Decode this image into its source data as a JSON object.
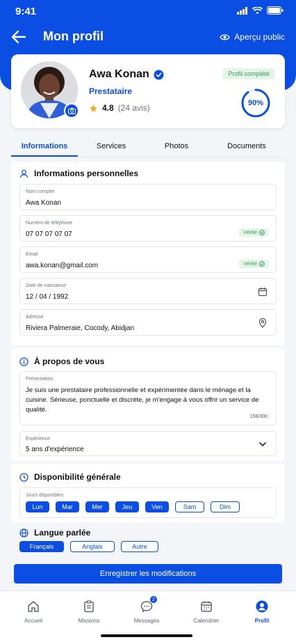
{
  "status": {
    "time": "9:41"
  },
  "header": {
    "title": "Mon profil",
    "preview_label": "Aperçu public"
  },
  "profile": {
    "name": "Awa Konan",
    "role": "Prestataire",
    "rating": "4.8",
    "reviews": "(24 avis)",
    "complete_badge": "Profil complété",
    "completion_percent": 90,
    "completion_label": "90%"
  },
  "tabs": [
    "Informations",
    "Services",
    "Photos",
    "Documents"
  ],
  "personal": {
    "title": "Informations personnelles",
    "fields": [
      {
        "label": "Nom complet",
        "value": "Awa Konan"
      },
      {
        "label": "Numéro de téléphone",
        "value": "07 07 07 07 07",
        "badge": "Vérifié"
      },
      {
        "label": "Email",
        "value": "awa.konan@gmail.com",
        "badge": "Vérifié"
      },
      {
        "label": "Date de naissance",
        "value": "12 / 04 / 1992"
      },
      {
        "label": "Adresse",
        "value": "Riviera Palmeraie, Cocody, Abidjan"
      }
    ]
  },
  "about": {
    "title": "À propos de vous",
    "presentation_label": "Présentation",
    "presentation_text": "Je suis une prestataire professionnelle et expérimentée dans le ménage et la cuisine. Sérieuse, ponctuelle et discrète, je m'engage à vous offrir un service de qualité.",
    "counter": "156/300",
    "experience_label": "Expérience",
    "experience_value": "5 ans d'expérience"
  },
  "availability": {
    "title": "Disponibilité générale",
    "days_label": "Jours disponibles",
    "days": [
      {
        "label": "Lun",
        "on": true
      },
      {
        "label": "Mar",
        "on": true
      },
      {
        "label": "Mer",
        "on": true
      },
      {
        "label": "Jeu",
        "on": true
      },
      {
        "label": "Ven",
        "on": true
      },
      {
        "label": "Sam",
        "on": false
      },
      {
        "label": "Dim",
        "on": false
      }
    ]
  },
  "languages": {
    "title": "Langue parlée",
    "items": [
      {
        "label": "Français",
        "on": true
      },
      {
        "label": "Anglais",
        "on": false
      },
      {
        "label": "Autre",
        "on": false
      }
    ]
  },
  "save_label": "Enregistrer les modifications",
  "nav": {
    "items": [
      "Accueil",
      "Missions",
      "Messages",
      "Calendrier",
      "Profil"
    ],
    "messages_badge": "2"
  },
  "colors": {
    "primary": "#0a4ee4",
    "success": "#2e9f52",
    "star": "#f5a623"
  }
}
